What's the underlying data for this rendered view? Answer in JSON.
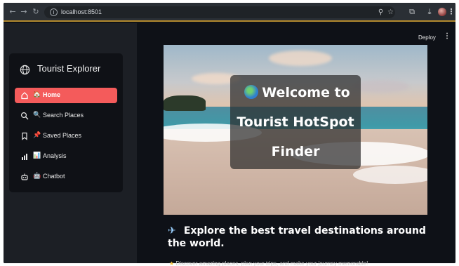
{
  "browser": {
    "url": "localhost:8501",
    "nav_icons": {
      "back": "back-arrow-icon",
      "forward": "forward-arrow-icon",
      "reload": "reload-icon"
    },
    "toolbar_icons": [
      "zoom-icon",
      "star-icon",
      "extensions-icon",
      "download-icon",
      "profile-avatar"
    ]
  },
  "app_header": {
    "deploy_label": "Deploy",
    "menu_icon": "kebab-menu-icon"
  },
  "sidebar": {
    "title": "Tourist Explorer",
    "title_icon": "globe-icon",
    "items": [
      {
        "label": "Home",
        "emoji": "🏠",
        "icon": "home-icon",
        "active": true
      },
      {
        "label": "Search Places",
        "emoji": "🔍",
        "icon": "search-icon",
        "active": false
      },
      {
        "label": "Saved Places",
        "emoji": "📌",
        "icon": "bookmark-icon",
        "active": false
      },
      {
        "label": "Analysis",
        "emoji": "📊",
        "icon": "bar-chart-icon",
        "active": false
      },
      {
        "label": "Chatbot",
        "emoji": "🤖",
        "icon": "robot-icon",
        "active": false
      }
    ],
    "active_color": "#f45b5b"
  },
  "hero": {
    "line1": "Welcome to",
    "line2": "Tourist HotSpot",
    "line3": "Finder",
    "globe_icon": "globe-emoji-icon"
  },
  "main": {
    "tagline": "Explore the best travel destinations around the world.",
    "tagline_icon": "airplane-icon",
    "subtagline": "Discover amazing places, plan your trips, and make your journey memorable!",
    "subtagline_icon": "sparkle-icon"
  }
}
